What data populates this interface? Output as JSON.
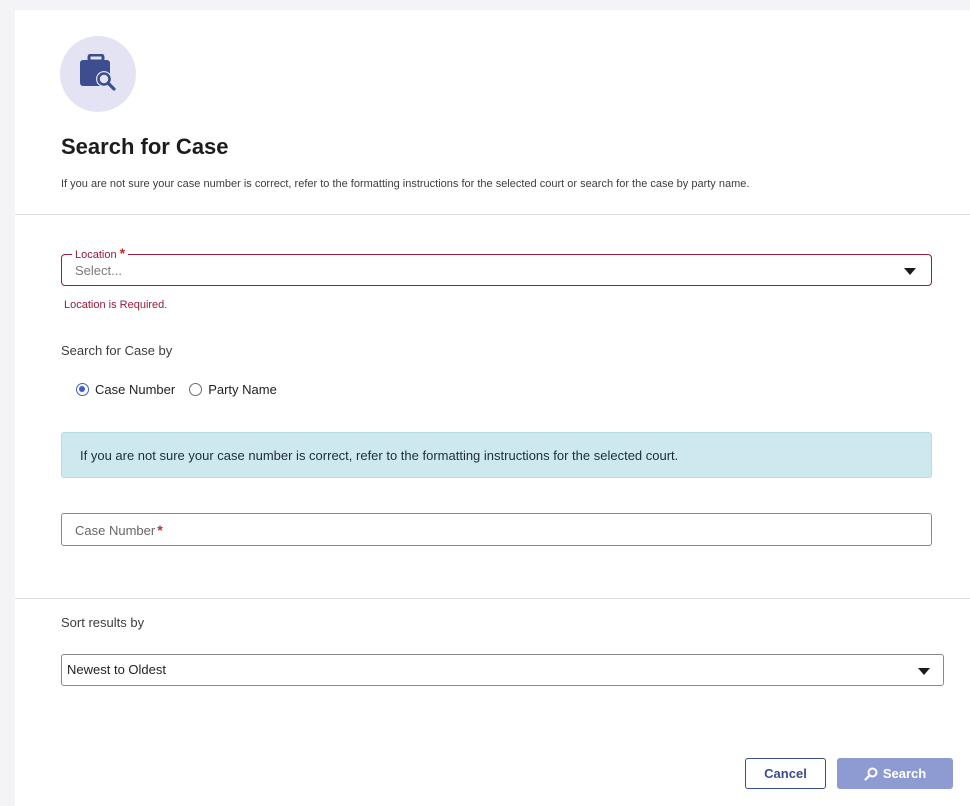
{
  "header": {
    "icon": "briefcase-search-icon",
    "title": "Search for Case",
    "subtitle": "If you are not sure your case number is correct, refer to the formatting instructions for the selected court or search for the case by party name."
  },
  "location": {
    "label": "Location",
    "required_mark": "*",
    "placeholder": "Select...",
    "error": "Location is Required."
  },
  "search_by": {
    "label": "Search for Case by",
    "options": [
      {
        "label": "Case Number",
        "selected": true
      },
      {
        "label": "Party Name",
        "selected": false
      }
    ]
  },
  "info": {
    "text": "If you are not sure your case number is correct, refer to the formatting instructions for the selected court."
  },
  "case_number": {
    "placeholder": "Case Number",
    "required_mark": "*"
  },
  "sort": {
    "label": "Sort results by",
    "value": "Newest to Oldest"
  },
  "actions": {
    "cancel_label": "Cancel",
    "search_label": "Search"
  },
  "colors": {
    "accent": "#3b4c8c",
    "error": "#9a1b3a",
    "info_bg": "#cde9ef",
    "search_button": "#8e9bd2"
  }
}
